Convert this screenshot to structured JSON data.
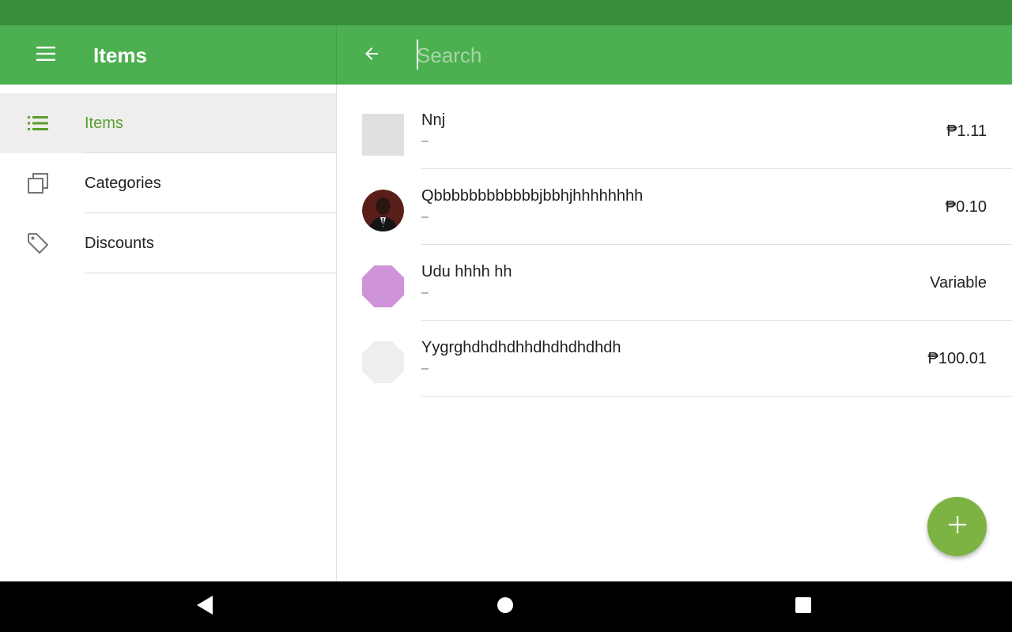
{
  "app": {
    "title": "Items",
    "accent_color": "#4caf50",
    "status_bar_color": "#388e3c",
    "selected_color": "#5a9e2f",
    "fab_color": "#7cb342"
  },
  "toolbar": {
    "menu_icon": "hamburger-menu-icon",
    "back_icon": "arrow-back-icon"
  },
  "search": {
    "placeholder": "Search",
    "value": ""
  },
  "sidebar": {
    "items": [
      {
        "label": "Items",
        "icon": "list-icon",
        "selected": true
      },
      {
        "label": "Categories",
        "icon": "categories-icon",
        "selected": false
      },
      {
        "label": "Discounts",
        "icon": "tag-icon",
        "selected": false
      }
    ]
  },
  "items": [
    {
      "name": "Nnj",
      "subtitle": "–",
      "price": "₱1.11",
      "thumb": "gray-square"
    },
    {
      "name": "Qbbbbbbbbbbbbjbbhjhhhhhhhh",
      "subtitle": "–",
      "price": "₱0.10",
      "thumb": "photo"
    },
    {
      "name": "Udu hhhh hh",
      "subtitle": "–",
      "price": "Variable",
      "thumb": "purple-octagon"
    },
    {
      "name": "Yygrghdhdhdhhdhdhdhdhdh",
      "subtitle": "–",
      "price": "₱100.01",
      "thumb": "light-gray-octagon"
    }
  ],
  "fab": {
    "icon": "plus-icon"
  },
  "system_nav": {
    "back_icon": "nav-back-icon",
    "home_icon": "nav-home-icon",
    "recents_icon": "nav-recents-icon"
  }
}
